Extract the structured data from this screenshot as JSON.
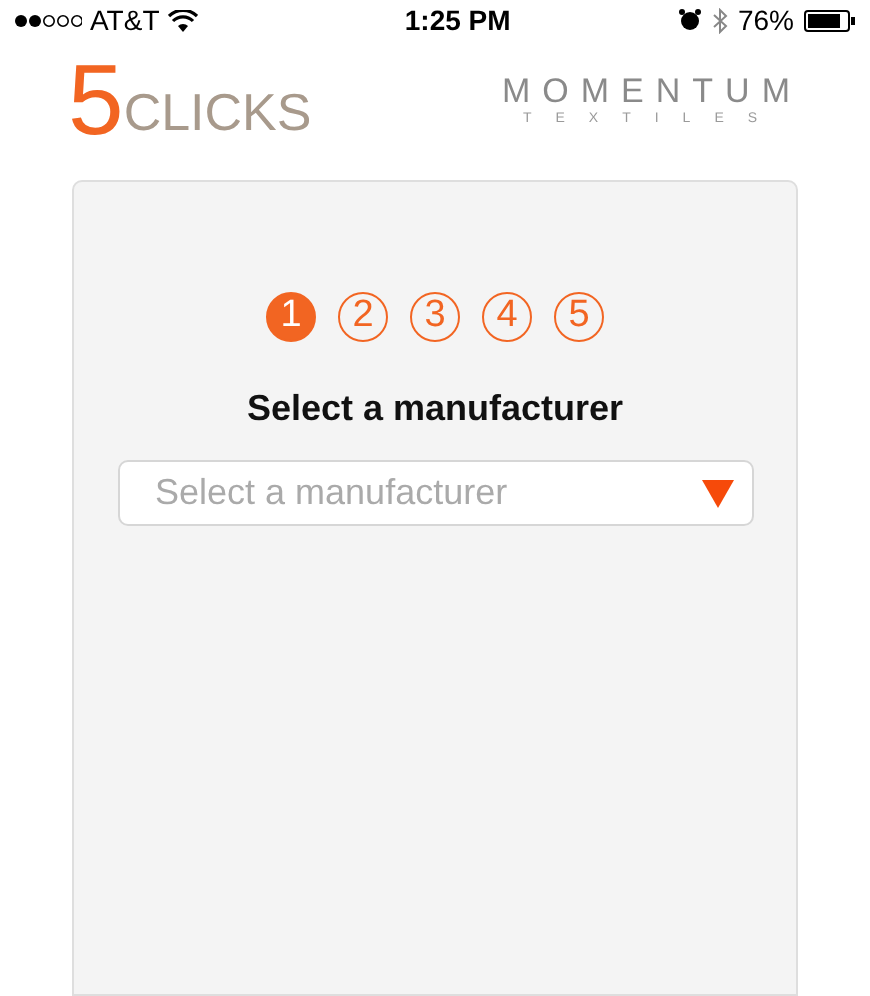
{
  "status_bar": {
    "carrier": "AT&T",
    "time": "1:25 PM",
    "battery": "76%"
  },
  "header": {
    "logo_number": "5",
    "logo_word": "CLICKS",
    "partner_name": "MOMENTUM",
    "partner_subtitle": "TEXTILES"
  },
  "steps": [
    {
      "label": "1",
      "selected": true
    },
    {
      "label": "2",
      "selected": false
    },
    {
      "label": "3",
      "selected": false
    },
    {
      "label": "4",
      "selected": false
    },
    {
      "label": "5",
      "selected": false
    }
  ],
  "heading": "Select a manufacturer",
  "dropdown": {
    "placeholder": "Select a manufacturer"
  }
}
